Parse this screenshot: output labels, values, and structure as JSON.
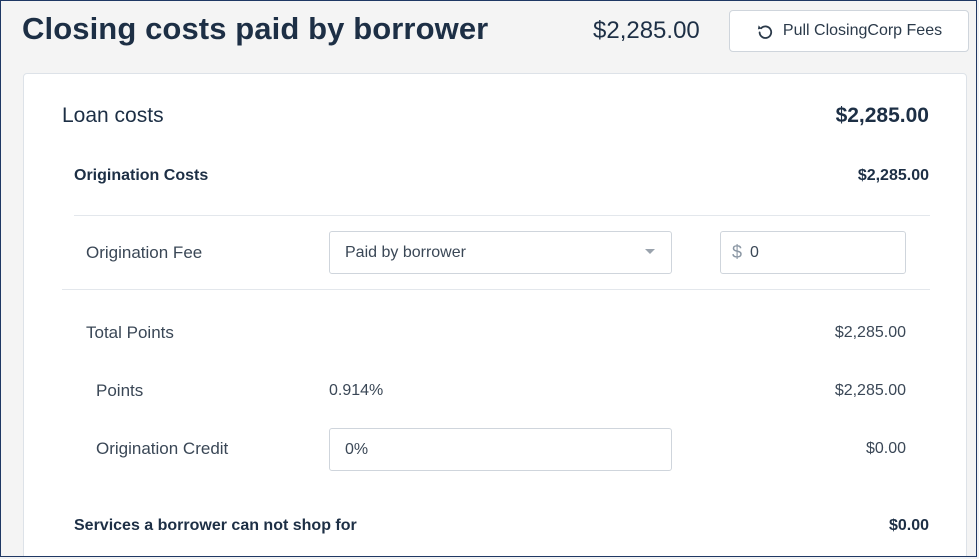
{
  "header": {
    "title": "Closing costs paid by borrower",
    "total": "$2,285.00",
    "pull_button_label": "Pull ClosingCorp Fees"
  },
  "loan_costs": {
    "title": "Loan costs",
    "total": "$2,285.00",
    "origination_costs": {
      "title": "Origination Costs",
      "total": "$2,285.00",
      "origination_fee": {
        "label": "Origination Fee",
        "paid_by": "Paid by borrower",
        "currency_symbol": "$",
        "amount": "0"
      },
      "total_points": {
        "label": "Total Points",
        "value": "$2,285.00"
      },
      "points": {
        "label": "Points",
        "percent": "0.914%",
        "value": "$2,285.00"
      },
      "origination_credit": {
        "label": "Origination Credit",
        "percent": "0%",
        "value": "$0.00"
      }
    },
    "services_cannot_shop": {
      "title": "Services a borrower can not shop for",
      "total": "$0.00"
    }
  }
}
